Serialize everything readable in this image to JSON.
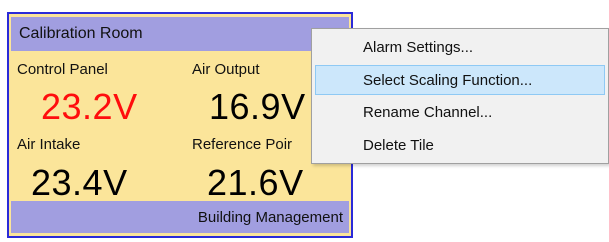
{
  "tile": {
    "title": "Calibration Room",
    "footer": "Building Management",
    "colors": {
      "background": "#fbe59a",
      "header": "#a19ee0",
      "border": "#2b2bd8",
      "alarm_value": "#ff0d0d"
    },
    "channels": [
      {
        "label": "Control Panel",
        "value": "23.2V",
        "state": "alarm"
      },
      {
        "label": "Air Output",
        "value": "16.9V",
        "state": "normal"
      },
      {
        "label": "Air Intake",
        "value": "23.4V",
        "state": "normal"
      },
      {
        "label": "Reference Poir",
        "value": "21.6V",
        "state": "normal"
      }
    ]
  },
  "context_menu": {
    "items": [
      {
        "label": "Alarm Settings..."
      },
      {
        "label": "Select Scaling Function...",
        "highlighted": true
      },
      {
        "label": "Rename Channel..."
      },
      {
        "label": "Delete Tile"
      }
    ],
    "colors": {
      "highlight_bg": "#cce7fb",
      "highlight_border": "#8ec9f4"
    }
  }
}
